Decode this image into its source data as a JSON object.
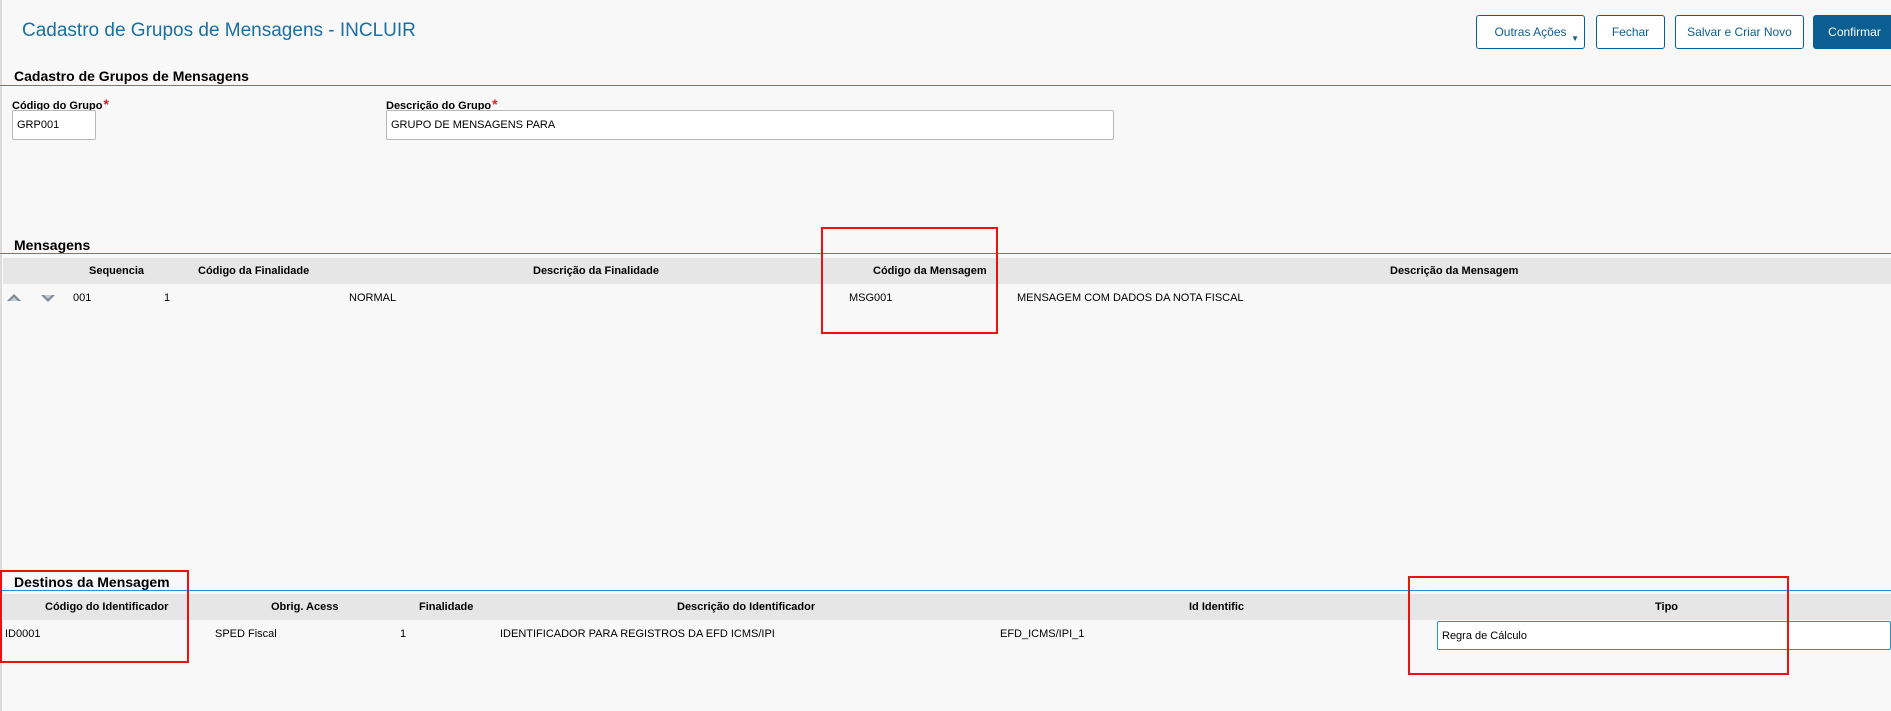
{
  "page": {
    "title": "Cadastro de Grupos de Mensagens - INCLUIR"
  },
  "toolbar": {
    "other_actions": "Outras Ações",
    "close": "Fechar",
    "save_and_new": "Salvar e Criar Novo",
    "confirm": "Confirmar"
  },
  "form_section": {
    "title": "Cadastro de Grupos de Mensagens",
    "group_code": {
      "label": "Código do Grupo",
      "value": "GRP001"
    },
    "group_description": {
      "label": "Descrição do Grupo",
      "value": "GRUPO DE MENSAGENS PARA"
    }
  },
  "messages_section": {
    "title": "Mensagens",
    "headers": [
      "Sequencia",
      "Código da Finalidade",
      "Descrição da Finalidade",
      "Código da Mensagem",
      "Descrição da Mensagem"
    ],
    "rows": [
      {
        "sequence": "001",
        "purpose_code": "1",
        "purpose_description": "NORMAL",
        "message_code": "MSG001",
        "message_description": "MENSAGEM COM DADOS DA NOTA FISCAL"
      }
    ]
  },
  "destinations_section": {
    "title": "Destinos da Mensagem",
    "headers": [
      "Código do Identificador",
      "Obrig. Acess",
      "Finalidade",
      "Descrição do Identificador",
      "Id Identific",
      "Tipo"
    ],
    "rows": [
      {
        "identifier_code": "ID0001",
        "mandatory_access": "SPED Fiscal",
        "purpose": "1",
        "identifier_description": "IDENTIFICADOR PARA REGISTROS DA EFD ICMS/IPI",
        "identifier_id": "EFD_ICMS/IPI_1",
        "type": "Regra de Cálculo"
      }
    ]
  },
  "colors": {
    "accent": "#0b5e91",
    "title": "#1a6fa3",
    "section_rule": "#2a8fd0",
    "required": "#e02020",
    "annotation": "#ee1111",
    "grid_header_bg": "#e6e6e6"
  }
}
